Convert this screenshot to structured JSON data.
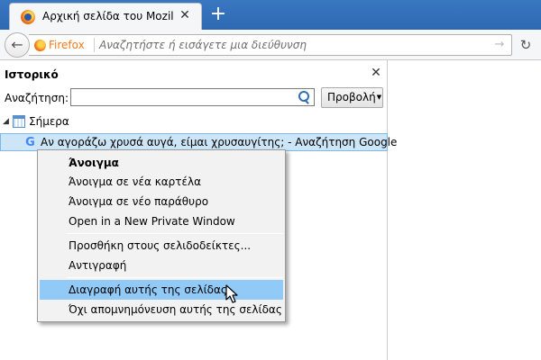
{
  "tab": {
    "title": "Αρχική σελίδα του Mozilla...",
    "close": "✕"
  },
  "newtab": "+",
  "navbar": {
    "back": "←",
    "brand": "Firefox",
    "placeholder": "Αναζητήστε ή εισάγετε μια διεύθυνση",
    "go": "→",
    "reload": "↻"
  },
  "sidebar": {
    "title": "Ιστορικό",
    "close": "✕",
    "search_label": "Αναζήτηση:",
    "search_value": "",
    "view_button": "Προβολή",
    "view_arrow": "▼",
    "tree": {
      "twisty": "◢",
      "group_label": "Σήμερα",
      "entry_icon": "G",
      "entry_label": "Αν αγοράζω χρυσά αυγά, είμαι χρυσαυγίτης; - Αναζήτηση Google"
    }
  },
  "context_menu": {
    "items": [
      {
        "label": "Άνοιγμα"
      },
      {
        "label": "Άνοιγμα σε νέα καρτέλα"
      },
      {
        "label": "Άνοιγμα σε νέο παράθυρο"
      },
      {
        "label": "Open in a New Private Window"
      },
      {
        "label": "Προσθήκη στους σελιδοδείκτες..."
      },
      {
        "label": "Αντιγραφή"
      },
      {
        "label": "Διαγραφή αυτής της σελίδας"
      },
      {
        "label": "Όχι απομνημόνευση αυτής της σελίδας"
      }
    ]
  }
}
